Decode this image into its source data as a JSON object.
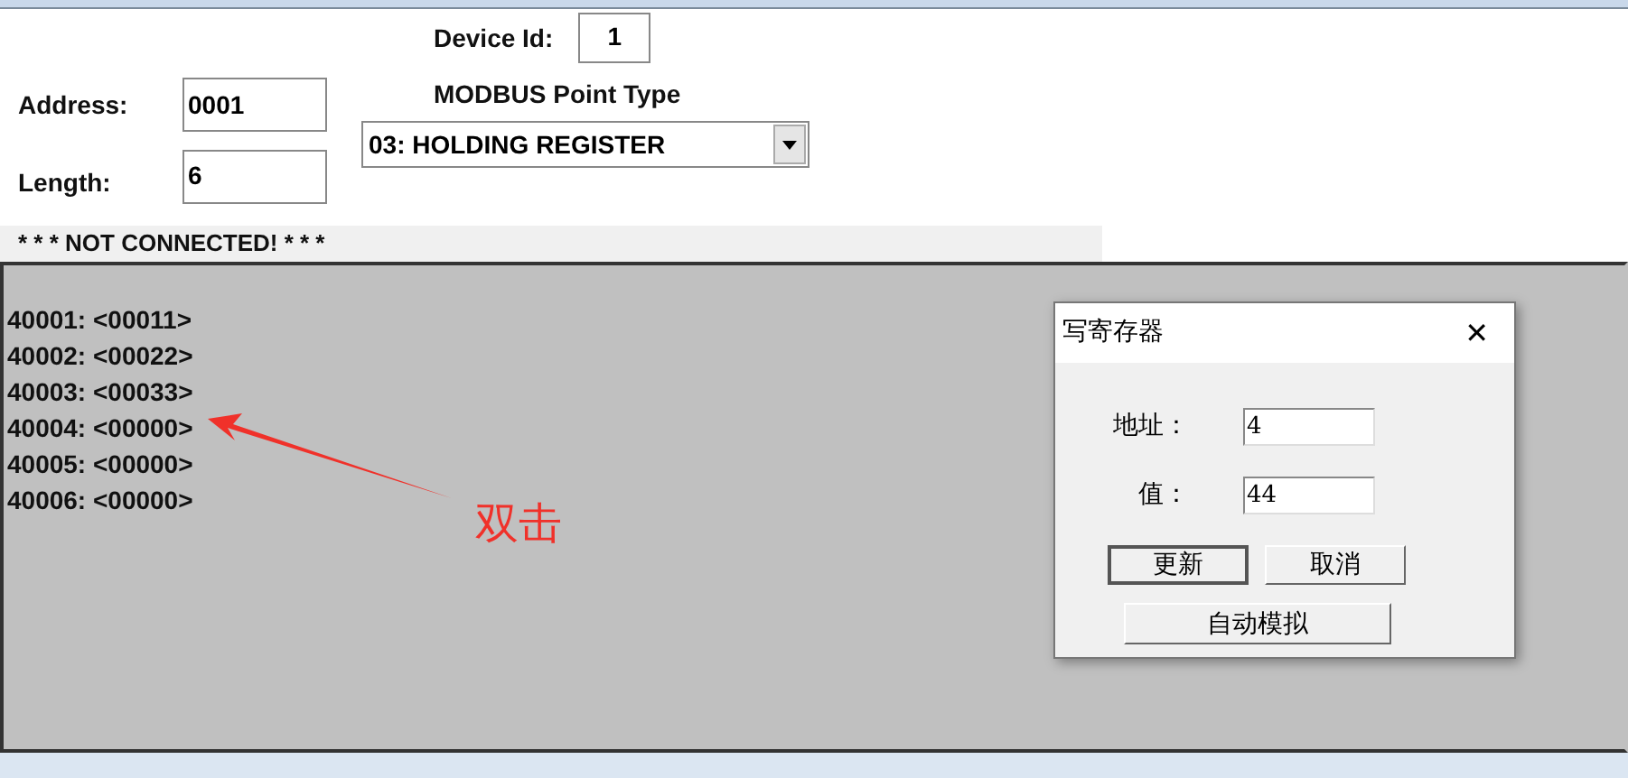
{
  "form": {
    "device_id": {
      "label": "Device Id:",
      "value": "1"
    },
    "address": {
      "label": "Address:",
      "value": "0001"
    },
    "length": {
      "label": "Length:",
      "value": "6"
    },
    "point_type": {
      "label": "MODBUS Point Type",
      "value": "03: HOLDING REGISTER"
    }
  },
  "status": "* * * NOT CONNECTED! * * *",
  "registers": [
    "40001: <00011>",
    "40002: <00022>",
    "40003: <00033>",
    "40004: <00000>",
    "40005: <00000>",
    "40006: <00000>"
  ],
  "annotation": {
    "text": "双击"
  },
  "dialog": {
    "title": "写寄存器",
    "close": "✕",
    "fields": [
      {
        "label": "地址：",
        "value": "4"
      },
      {
        "label": "值：",
        "value": "44"
      }
    ],
    "buttons": [
      {
        "label": "更新",
        "default": true
      },
      {
        "label": "取消",
        "default": false
      }
    ],
    "wide_button": "自动模拟"
  }
}
